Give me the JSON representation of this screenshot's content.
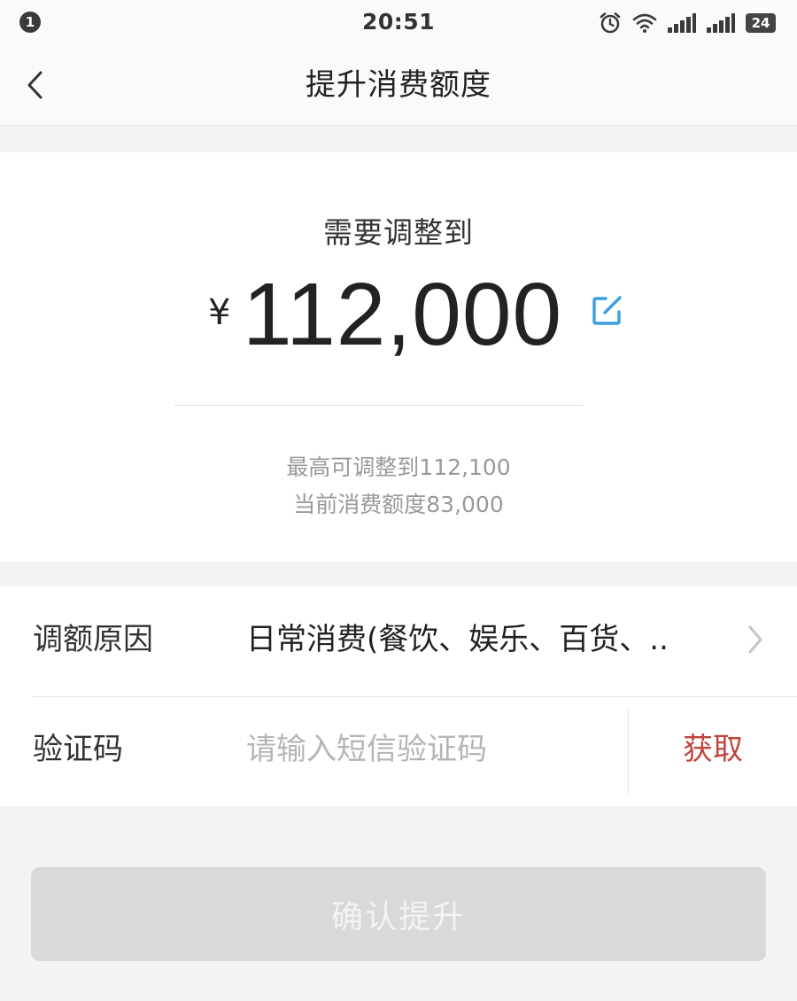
{
  "status_bar": {
    "notification_count": "1",
    "time": "20:51",
    "icons": [
      "alarm-icon",
      "wifi-icon",
      "signal-icon",
      "signal-icon"
    ],
    "battery": "24"
  },
  "nav": {
    "back_icon": "chevron-left-icon",
    "title": "提升消费额度"
  },
  "amount": {
    "heading": "需要调整到",
    "currency": "¥",
    "value": "112,000",
    "edit_icon": "edit-icon",
    "max_text": "最高可调整到112,100",
    "current_text": "当前消费额度83,000"
  },
  "form": {
    "reason": {
      "label": "调额原因",
      "value": "日常消费(餐饮、娱乐、百货、..",
      "icon": "chevron-right-icon"
    },
    "code": {
      "label": "验证码",
      "placeholder": "请输入短信验证码",
      "value": "",
      "get_label": "获取"
    }
  },
  "confirm": {
    "label": "确认提升"
  },
  "colors": {
    "accent_red": "#c0433d",
    "edit_blue": "#3b9ee0",
    "disabled_button": "#d9d9d9"
  }
}
